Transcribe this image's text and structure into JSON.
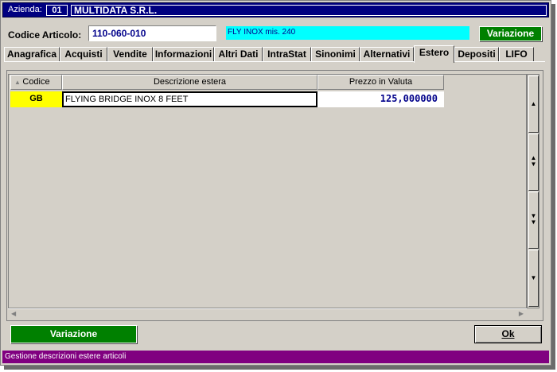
{
  "header": {
    "azienda_label": "Azienda:",
    "azienda_code": "01",
    "azienda_name": "MULTIDATA S.R.L."
  },
  "article": {
    "label": "Codice Articolo:",
    "code": "110-060-010",
    "description": "FLY INOX mis. 240",
    "variazione_label": "Variazione"
  },
  "tabs": [
    {
      "label": "Anagrafica"
    },
    {
      "label": "Acquisti"
    },
    {
      "label": "Vendite"
    },
    {
      "label": "Informazioni"
    },
    {
      "label": "Altri Dati"
    },
    {
      "label": "IntraStat"
    },
    {
      "label": "Sinonimi"
    },
    {
      "label": "Alternativi"
    },
    {
      "label": "Estero",
      "active": true
    },
    {
      "label": "Depositi"
    },
    {
      "label": "LIFO"
    }
  ],
  "grid": {
    "columns": [
      "Codice",
      "Descrizione estera",
      "Prezzo in Valuta"
    ],
    "rows": [
      {
        "codice": "GB",
        "descrizione": "FLYING BRIDGE INOX 8 FEET",
        "prezzo": "125,000000"
      }
    ]
  },
  "footer": {
    "variazione_label": "Variazione",
    "ok_label": "Ok"
  },
  "status": "Gestione descrizioni estere articoli",
  "colors": {
    "title_bg": "#000080",
    "accent_green": "#008000",
    "cyan_field": "#00ffff",
    "yellow_cell": "#ffff00",
    "status_bg": "#800080"
  }
}
